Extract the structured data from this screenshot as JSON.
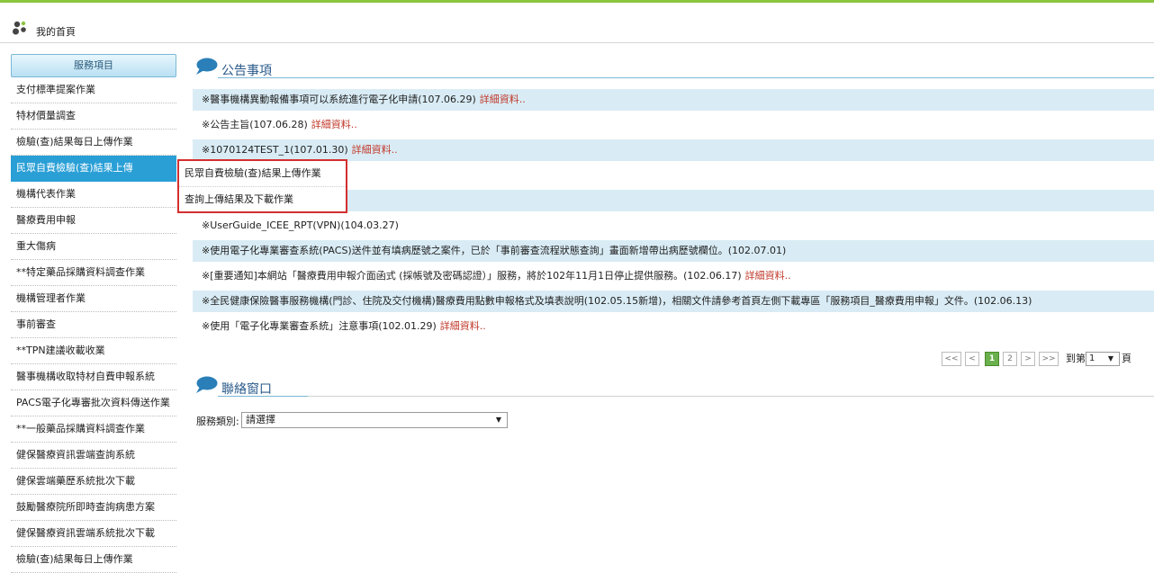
{
  "header": {
    "home_label": "我的首頁"
  },
  "sidebar": {
    "title": "服務項目",
    "items": [
      "支付標準提案作業",
      "特材價量調查",
      "檢驗(查)結果每日上傳作業",
      "民眾自費檢驗(查)結果上傳",
      "機構代表作業",
      "醫療費用申報",
      "重大傷病",
      "**特定藥品採購資料調查作業",
      "機構管理者作業",
      "事前審查",
      "**TPN建議收載收業",
      "醫事機構收取特材自費申報系統",
      "PACS電子化專審批次資料傳送作業",
      "**一般藥品採購資料調查作業",
      "健保醫療資訊雲端查詢系統",
      "健保雲端藥歷系統批次下載",
      "鼓勵醫療院所即時查詢病患方案",
      "健保醫療資訊雲端系統批次下載",
      "檢驗(查)結果每日上傳作業"
    ]
  },
  "flyout": {
    "items": [
      "民眾自費檢驗(查)結果上傳作業",
      "查詢上傳結果及下載作業"
    ]
  },
  "announcements": {
    "title": "公告事項",
    "more_label": "詳細資料..",
    "rows": [
      "※醫事機構異動報備事項可以系統進行電子化申請(107.06.29)",
      "※公告主旨(107.06.28)",
      "※1070124TEST_1(107.01.30)",
      "※",
      "※",
      "※UserGuide_ICEE_RPT(VPN)(104.03.27)",
      "※使用電子化專業審查系統(PACS)送件並有填病歷號之案件，已於「事前審查流程狀態查詢」畫面新增帶出病歷號欄位。(102.07.01)",
      "※[重要通知]本網站「醫療費用申報介面函式 (採帳號及密碼認證）」服務，將於102年11月1日停止提供服務。(102.06.17)",
      "※全民健康保險醫事服務機構(門診、住院及交付機構)醫療費用點數申報格式及填表說明(102.05.15新增)，相關文件請參考首頁左側下載專區「服務項目_醫療費用申報」文件。(102.06.13)",
      "※使用「電子化專業審查系統」注意事項(102.01.29)"
    ]
  },
  "pager": {
    "first": "<<",
    "prev": "<",
    "pages": [
      "1",
      "2"
    ],
    "next": ">",
    "last": ">>",
    "goto_prefix": "到第",
    "goto_value": "1",
    "goto_arrow": "▼",
    "goto_suffix": "頁"
  },
  "contact": {
    "title": "聯絡窗口",
    "category_label": "服務類別:",
    "category_value": "請選擇",
    "category_arrow": "▼"
  },
  "colors": {
    "accent": "#2a9fd6",
    "topline": "#8cc63f",
    "row_shade": "#d9ecf5",
    "link": "#c0392b",
    "flyout_border": "#d32f2f"
  }
}
